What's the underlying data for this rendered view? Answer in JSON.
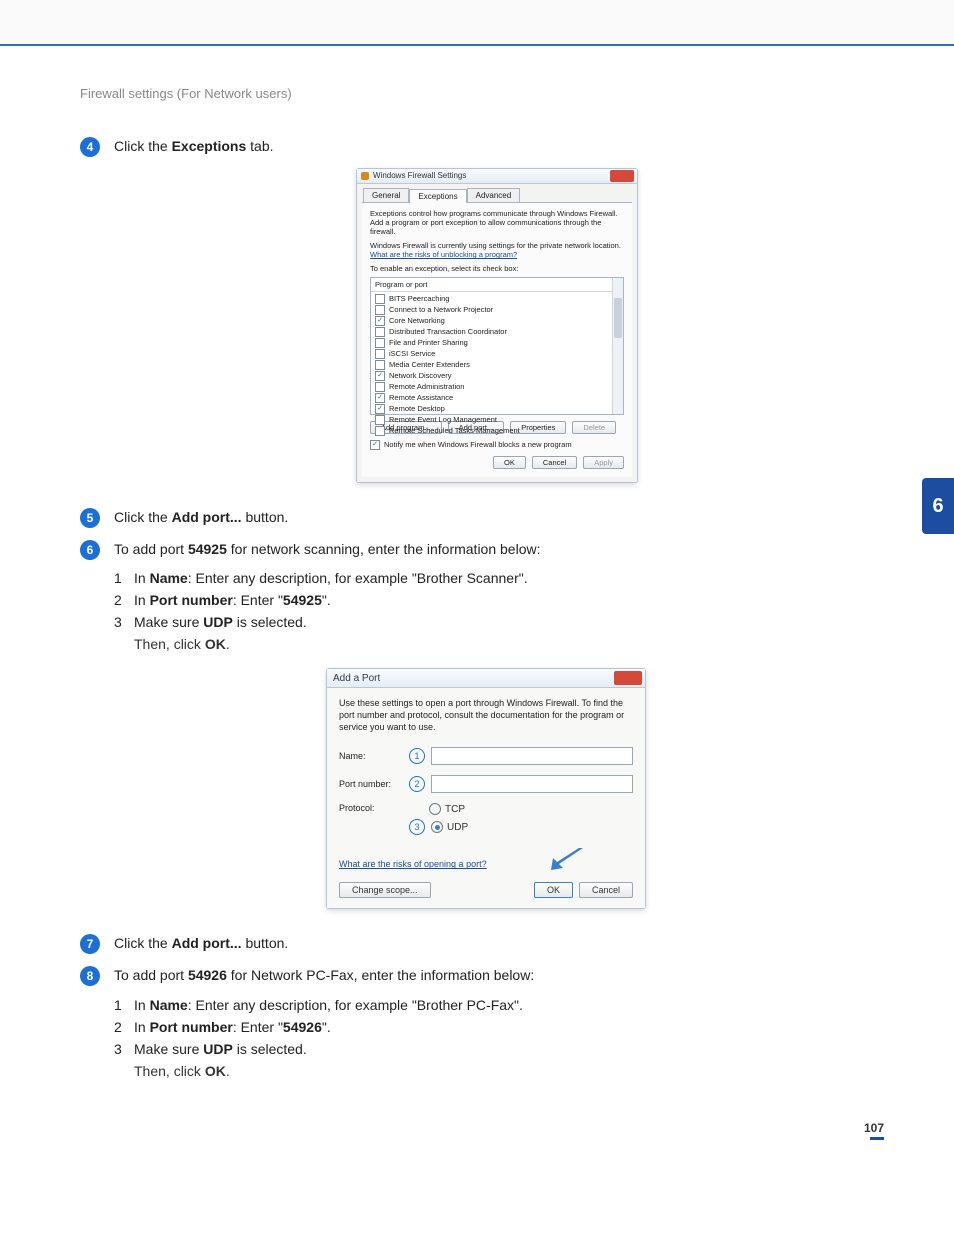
{
  "header": {
    "section_title": "Firewall settings (For Network users)"
  },
  "side_tab": {
    "chapter": "6"
  },
  "steps": [
    {
      "num": "4",
      "html": "Click the <b>Exceptions</b> tab."
    },
    {
      "num": "5",
      "html": "Click the <b>Add port...</b> button."
    },
    {
      "num": "6",
      "html": "To add port <b>54925</b> for network scanning, enter the information below:",
      "subs": [
        {
          "n": "1",
          "html": "In <b>Name</b>: Enter any description, for example \"Brother Scanner\"."
        },
        {
          "n": "2",
          "html": "In <b>Port number</b>: Enter \"<b>54925</b>\"."
        },
        {
          "n": "3",
          "html": "Make sure <b>UDP</b> is selected."
        }
      ],
      "then": "Then, click <b>OK</b>."
    },
    {
      "num": "7",
      "html": "Click the <b>Add port...</b> button."
    },
    {
      "num": "8",
      "html": "To add port <b>54926</b> for Network PC-Fax, enter the information below:",
      "subs": [
        {
          "n": "1",
          "html": "In <b>Name</b>: Enter any description, for example \"Brother PC-Fax\"."
        },
        {
          "n": "2",
          "html": "In <b>Port number</b>: Enter \"<b>54926</b>\"."
        },
        {
          "n": "3",
          "html": "Make sure <b>UDP</b> is selected."
        }
      ],
      "then": "Then, click <b>OK</b>."
    }
  ],
  "dialog1": {
    "title": "Windows Firewall Settings",
    "tabs": [
      "General",
      "Exceptions",
      "Advanced"
    ],
    "active_tab": 1,
    "para1": "Exceptions control how programs communicate through Windows Firewall. Add a program or port exception to allow communications through the firewall.",
    "para2a": "Windows Firewall is currently using settings for the private network location.",
    "para2b": "What are the risks of unblocking a program?",
    "para3": "To enable an exception, select its check box:",
    "list_header": "Program or port",
    "items": [
      {
        "label": "BITS Peercaching",
        "checked": false
      },
      {
        "label": "Connect to a Network Projector",
        "checked": false
      },
      {
        "label": "Core Networking",
        "checked": true
      },
      {
        "label": "Distributed Transaction Coordinator",
        "checked": false
      },
      {
        "label": "File and Printer Sharing",
        "checked": false
      },
      {
        "label": "iSCSI Service",
        "checked": false
      },
      {
        "label": "Media Center Extenders",
        "checked": false
      },
      {
        "label": "Network Discovery",
        "checked": true
      },
      {
        "label": "Remote Administration",
        "checked": false
      },
      {
        "label": "Remote Assistance",
        "checked": true
      },
      {
        "label": "Remote Desktop",
        "checked": true
      },
      {
        "label": "Remote Event Log Management",
        "checked": false
      },
      {
        "label": "Remote Scheduled Tasks Management",
        "checked": false
      }
    ],
    "buttons": {
      "add_program": "Add program...",
      "add_port": "Add port...",
      "properties": "Properties",
      "delete": "Delete"
    },
    "notify": "Notify me when Windows Firewall blocks a new program",
    "footer": {
      "ok": "OK",
      "cancel": "Cancel",
      "apply": "Apply"
    }
  },
  "dialog2": {
    "title": "Add a Port",
    "desc": "Use these settings to open a port through Windows Firewall. To find the port number and protocol, consult the documentation for the program or service you want to use.",
    "labels": {
      "name": "Name:",
      "port": "Port number:",
      "protocol": "Protocol:"
    },
    "markers": {
      "name": "1",
      "port": "2",
      "proto": "3"
    },
    "protocols": {
      "tcp": "TCP",
      "udp": "UDP"
    },
    "risks_link": "What are the risks of opening a port?",
    "buttons": {
      "change_scope": "Change scope...",
      "ok": "OK",
      "cancel": "Cancel"
    }
  },
  "page_number": "107"
}
